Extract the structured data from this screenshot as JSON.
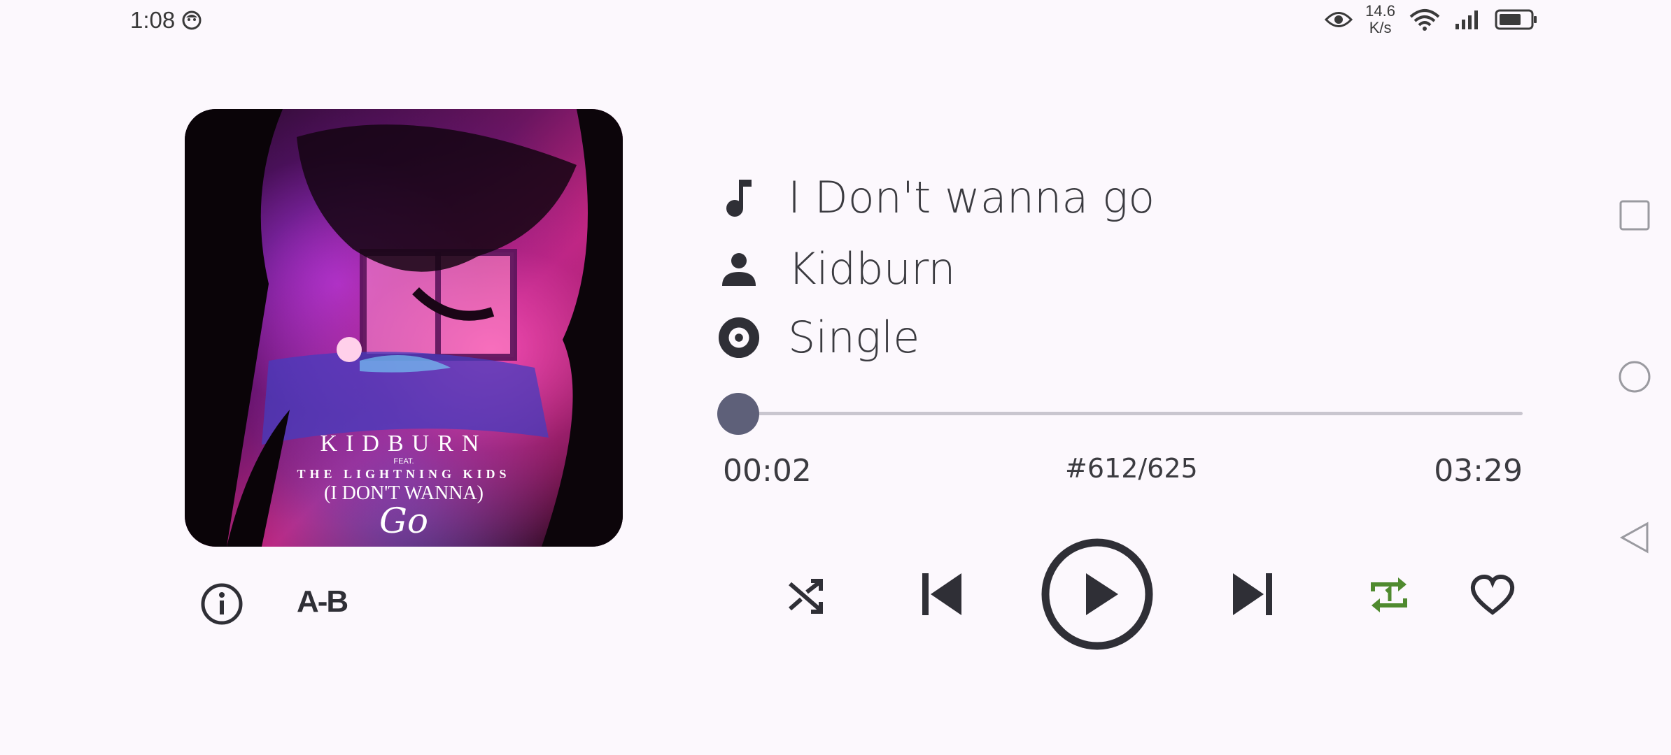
{
  "status_bar": {
    "time": "1:08",
    "net_speed_value": "14.6",
    "net_speed_unit": "K/s"
  },
  "album_art": {
    "artist": "KIDBURN",
    "feat": "FEAT.",
    "feat_artist": "THE LIGHTNING KIDS",
    "title_line": "(I DON'T WANNA)",
    "title_script": "Go"
  },
  "track": {
    "title": "I Don't wanna go",
    "artist": "Kidburn",
    "album": "Single"
  },
  "progress": {
    "current_time": "00:02",
    "total_time": "03:29",
    "queue_position": "#612/625",
    "fraction": 0.0096
  },
  "buttons": {
    "ab_repeat_label": "A-B"
  },
  "controls": {
    "repeat_mode": "repeat-one",
    "repeat_color": "#4f8a2f",
    "accent_color": "#5e6079"
  }
}
